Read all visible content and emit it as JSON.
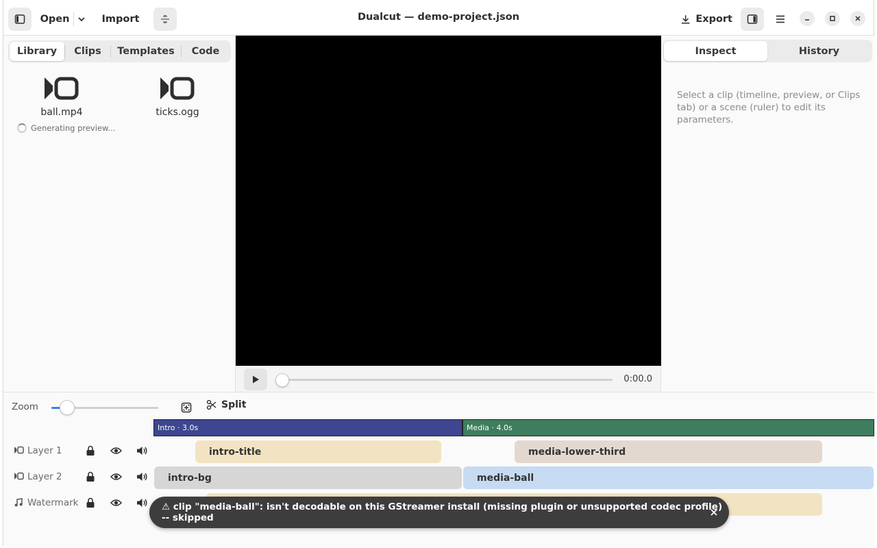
{
  "window": {
    "title": "Dualcut — demo-project.json"
  },
  "header": {
    "open_label": "Open",
    "import_label": "Import",
    "export_label": "Export"
  },
  "left_panel": {
    "tabs": [
      {
        "label": "Library",
        "active": true
      },
      {
        "label": "Clips",
        "active": false
      },
      {
        "label": "Templates",
        "active": false
      },
      {
        "label": "Code",
        "active": false
      }
    ],
    "assets": [
      {
        "name": "ball.mp4",
        "icon": "video-icon"
      },
      {
        "name": "ticks.ogg",
        "icon": "video-icon"
      }
    ],
    "generating_text": "Generating preview..."
  },
  "preview": {
    "time": "0:00.0",
    "progress": 0
  },
  "right_panel": {
    "tabs": [
      {
        "label": "Inspect",
        "active": true
      },
      {
        "label": "History",
        "active": false
      }
    ],
    "hint": "Select a clip (timeline, preview, or Clips tab) or a scene (ruler) to edit its parameters."
  },
  "timeline": {
    "zoom_label": "Zoom",
    "zoom_level": 0.15,
    "split_label": "Split",
    "scenes": [
      {
        "label": "Intro · 3.0s",
        "color": "#3d468f"
      },
      {
        "label": "Media · 4.0s",
        "color": "#3e7d5e"
      }
    ],
    "tracks": [
      {
        "name": "Layer 1",
        "icon": "video-icon"
      },
      {
        "name": "Layer 2",
        "icon": "video-icon"
      },
      {
        "name": "Watermark",
        "icon": "music-icon"
      }
    ],
    "clips": [
      {
        "label": "intro-title",
        "color": "#f2e4c2"
      },
      {
        "label": "media-lower-third",
        "color": "#e3d8d0"
      },
      {
        "label": "intro-bg",
        "color": "#d6d6d6"
      },
      {
        "label": "media-ball",
        "color": "#c6daf2"
      },
      {
        "label": "",
        "color": "#f2e4c2"
      }
    ]
  },
  "toast": {
    "message": "⚠ clip \"media-ball\": isn't decodable on this GStreamer install (missing plugin or unsupported codec profile) -- skipped"
  },
  "colors": {
    "accent": "#3584e4",
    "preview_bg": "#000000"
  }
}
